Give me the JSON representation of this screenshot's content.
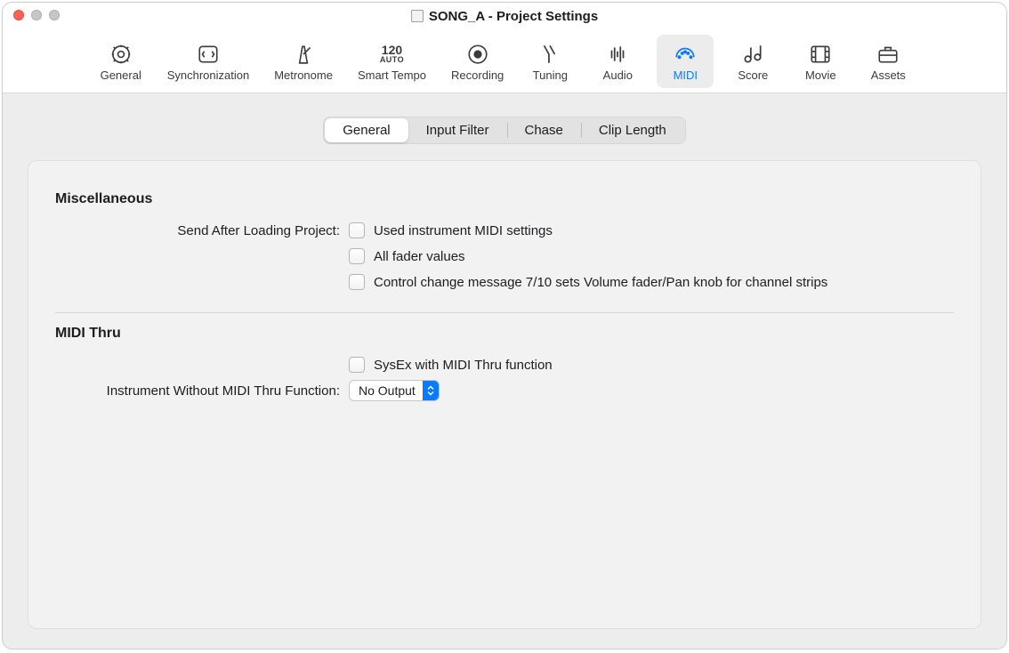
{
  "window": {
    "title": "SONG_A - Project Settings"
  },
  "toolbar": {
    "items": [
      {
        "label": "General"
      },
      {
        "label": "Synchronization"
      },
      {
        "label": "Metronome"
      },
      {
        "label": "Smart Tempo",
        "line1": "120",
        "line2": "AUTO"
      },
      {
        "label": "Recording"
      },
      {
        "label": "Tuning"
      },
      {
        "label": "Audio"
      },
      {
        "label": "MIDI"
      },
      {
        "label": "Score"
      },
      {
        "label": "Movie"
      },
      {
        "label": "Assets"
      }
    ]
  },
  "tabs": {
    "items": [
      "General",
      "Input Filter",
      "Chase",
      "Clip Length"
    ],
    "selected": "General"
  },
  "misc": {
    "title": "Miscellaneous",
    "send_after_label": "Send After Loading Project:",
    "cb1": "Used instrument MIDI settings",
    "cb2": "All fader values",
    "cb3": "Control change message 7/10 sets Volume fader/Pan knob for channel strips"
  },
  "midithru": {
    "title": "MIDI Thru",
    "cb1": "SysEx with MIDI Thru function",
    "instrument_label": "Instrument Without MIDI Thru Function:",
    "select_value": "No Output"
  }
}
